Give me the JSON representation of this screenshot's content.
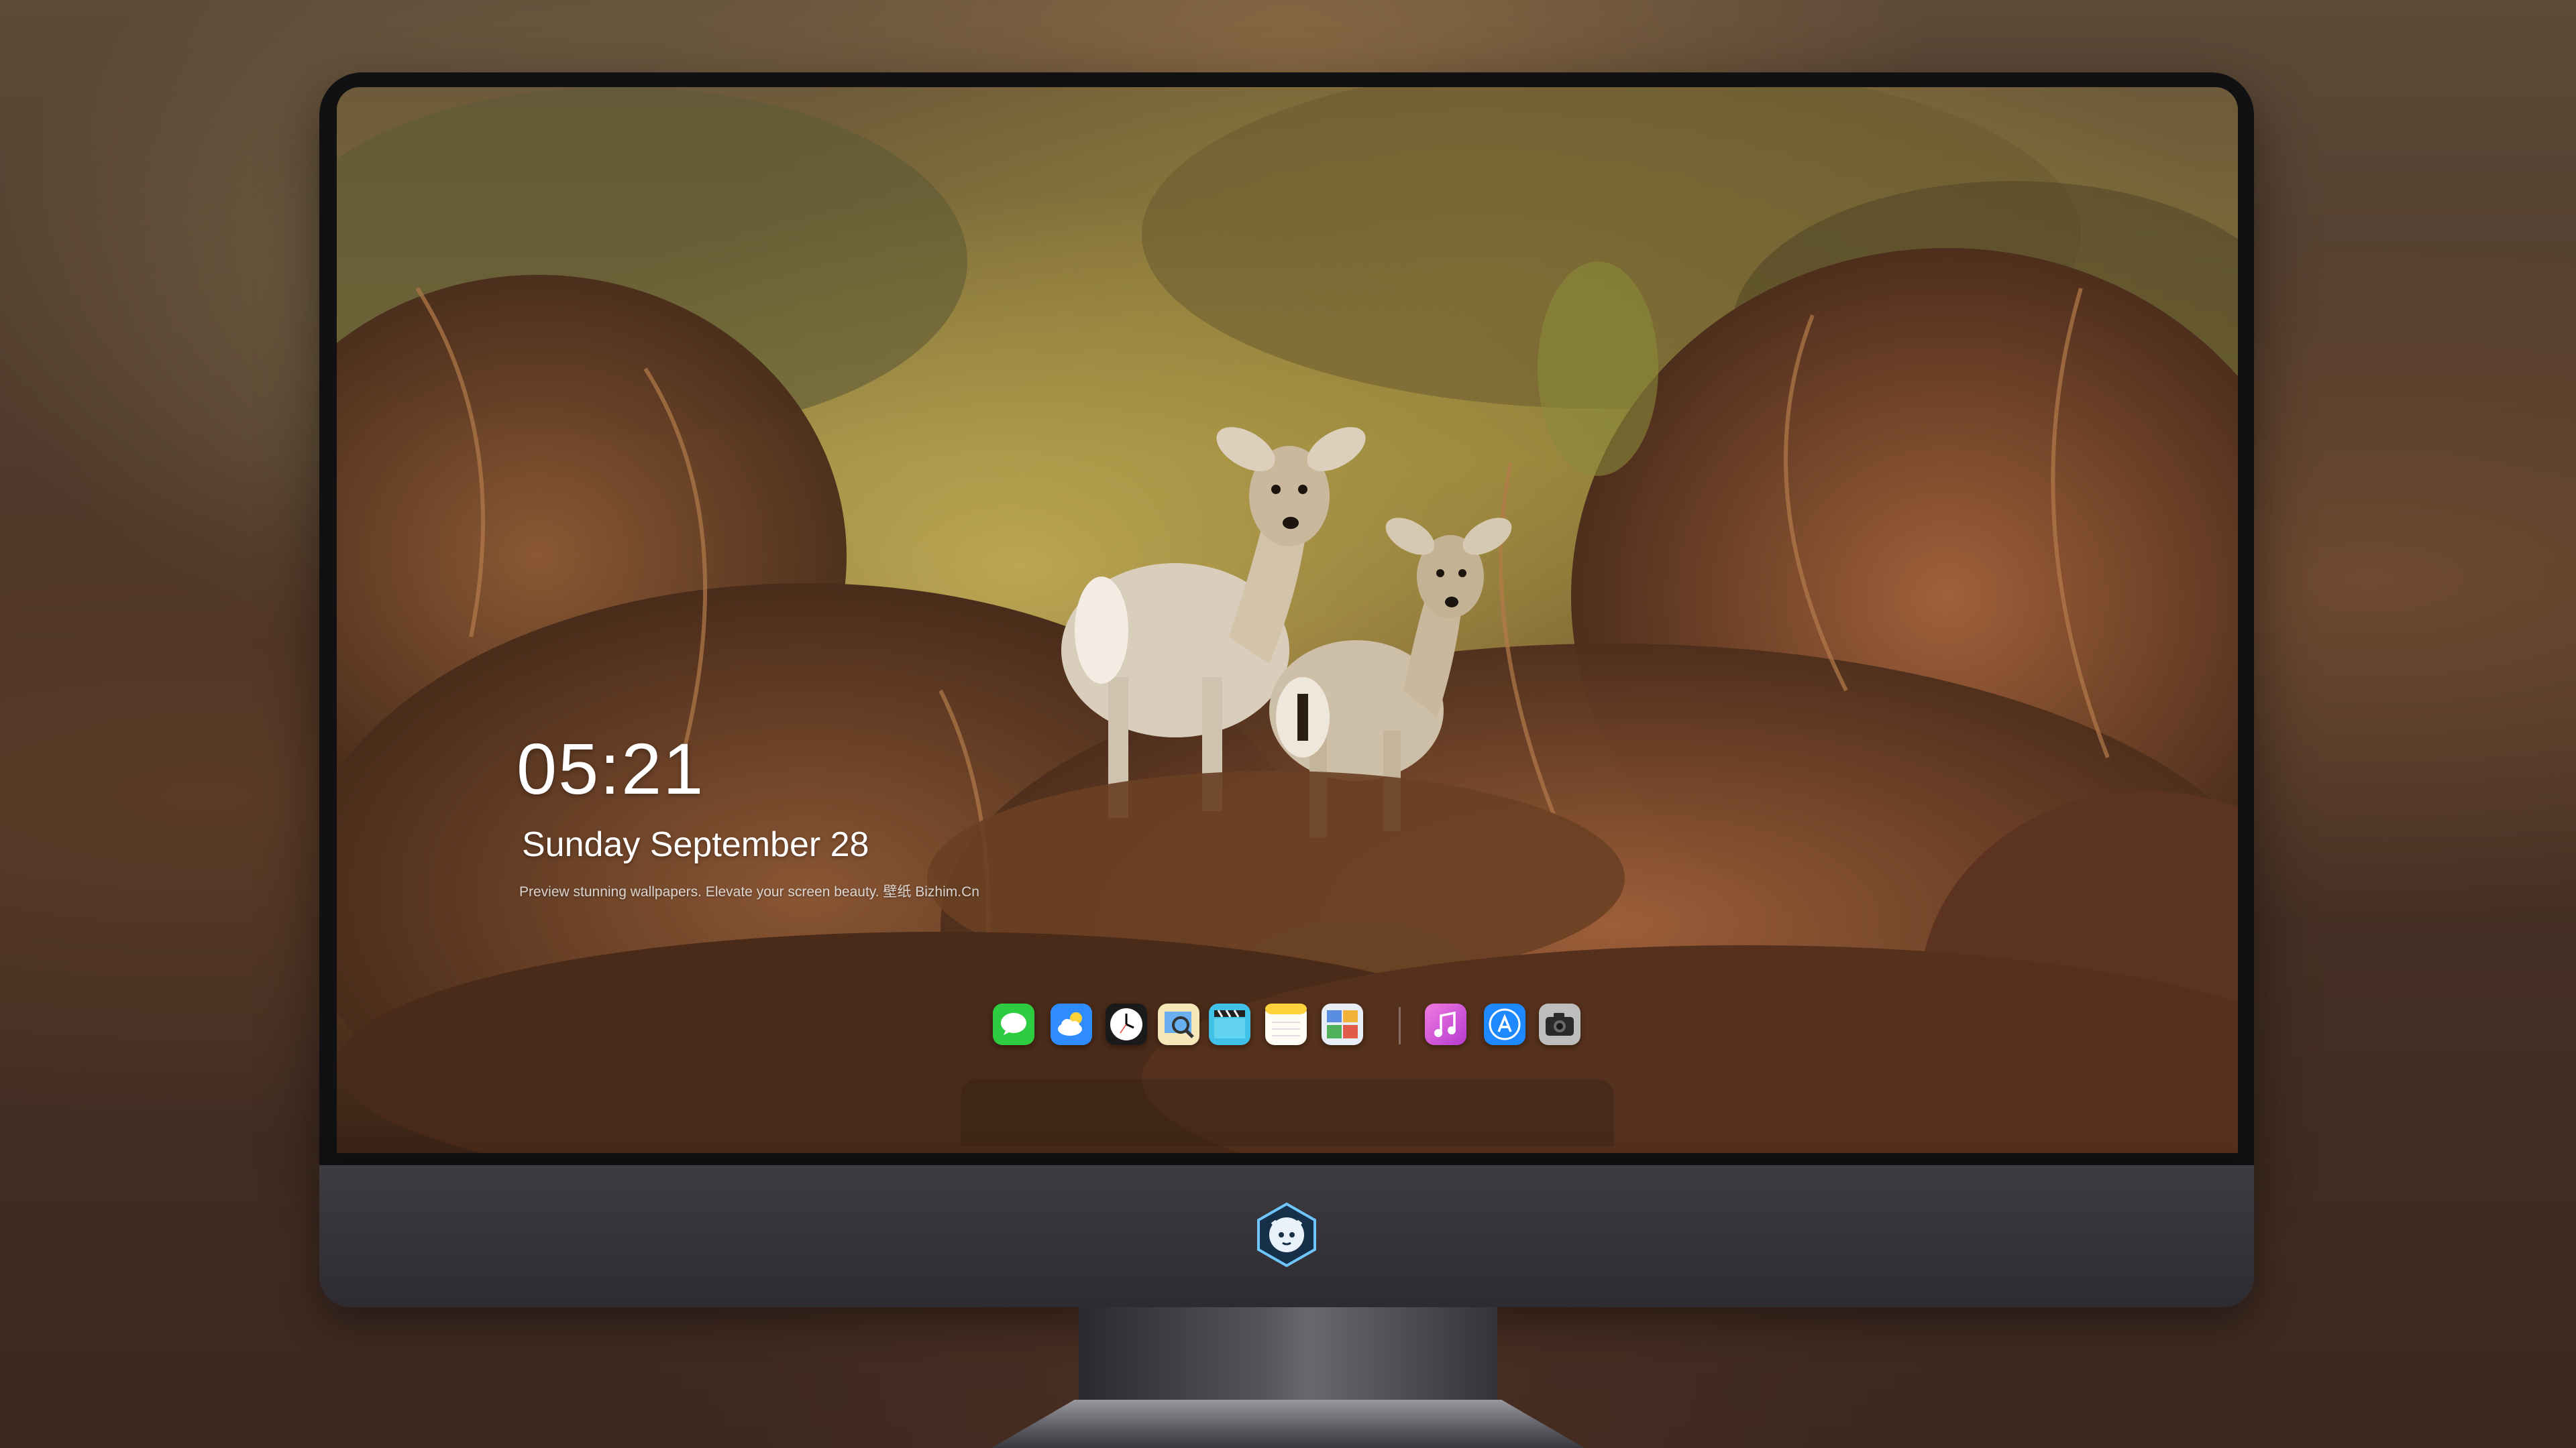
{
  "lock_screen": {
    "time": "05:21",
    "date": "Sunday September  28",
    "tagline": "Preview stunning wallpapers. Elevate your screen beauty. 壁纸 Bizhim.Cn"
  },
  "dock": {
    "apps": [
      {
        "name": "messages",
        "icon": "chat-bubble-icon",
        "color": "#2ecc40"
      },
      {
        "name": "weather",
        "icon": "cloud-icon",
        "color": "#2f8cff"
      },
      {
        "name": "clock",
        "icon": "clock-icon",
        "color": "#ffffff"
      },
      {
        "name": "preview",
        "icon": "magnifier-photo-icon",
        "color": "#f0c24a"
      },
      {
        "name": "videos",
        "icon": "clapperboard-icon",
        "color": "#3fc1e8"
      },
      {
        "name": "notes",
        "icon": "notepad-icon",
        "color": "#ffd23c"
      },
      {
        "name": "photo-gallery",
        "icon": "photos-icon",
        "color": "#6a9be6"
      },
      {
        "name": "music",
        "icon": "music-note-icon",
        "color": "#e45bd4"
      },
      {
        "name": "app-store",
        "icon": "app-store-icon",
        "color": "#1e88ff"
      },
      {
        "name": "camera",
        "icon": "camera-icon",
        "color": "#9b9b9b"
      }
    ]
  },
  "colors": {
    "chin": "#3e3c41",
    "bezel": "#111113"
  }
}
